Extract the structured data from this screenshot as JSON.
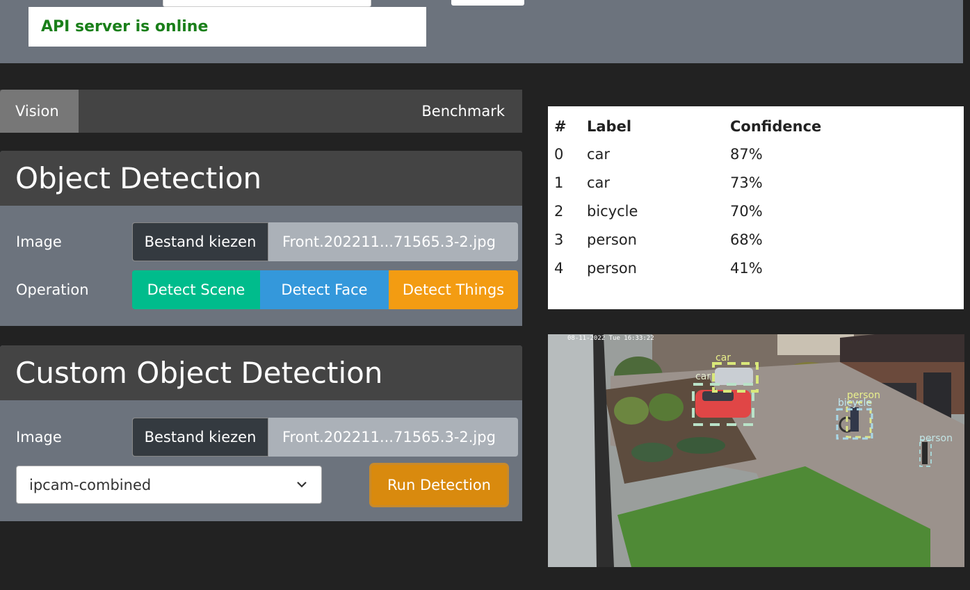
{
  "status": {
    "message": "API server is online"
  },
  "tabs": [
    {
      "label": "Vision"
    },
    {
      "label": "Benchmark"
    }
  ],
  "object_detection": {
    "title": "Object Detection",
    "image_label": "Image",
    "file_button": "Bestand kiezen",
    "file_name": "Front.202211...71565.3-2.jpg",
    "operation_label": "Operation",
    "buttons": {
      "scene": "Detect Scene",
      "face": "Detect Face",
      "things": "Detect Things"
    }
  },
  "custom_detection": {
    "title": "Custom Object Detection",
    "image_label": "Image",
    "file_button": "Bestand kiezen",
    "file_name": "Front.202211...71565.3-2.jpg",
    "model_selected": "ipcam-combined",
    "run_button": "Run Detection"
  },
  "results": {
    "headers": [
      "#",
      "Label",
      "Confidence"
    ],
    "rows": [
      [
        "0",
        "car",
        "87%"
      ],
      [
        "1",
        "car",
        "73%"
      ],
      [
        "2",
        "bicycle",
        "70%"
      ],
      [
        "3",
        "person",
        "68%"
      ],
      [
        "4",
        "person",
        "41%"
      ]
    ]
  },
  "photo": {
    "timestamp": "08-11-2022 Tue 16:33:22",
    "box_labels": [
      "car",
      "car",
      "person",
      "bicycle",
      "person"
    ]
  },
  "colors": {
    "topbar": "#6c737d",
    "panel_header": "#444444",
    "status_green": "#1a7f1a",
    "detect_scene": "#00bc8c",
    "detect_face": "#3498db",
    "detect_things": "#f39c12",
    "run_detection": "#d98a0e"
  }
}
